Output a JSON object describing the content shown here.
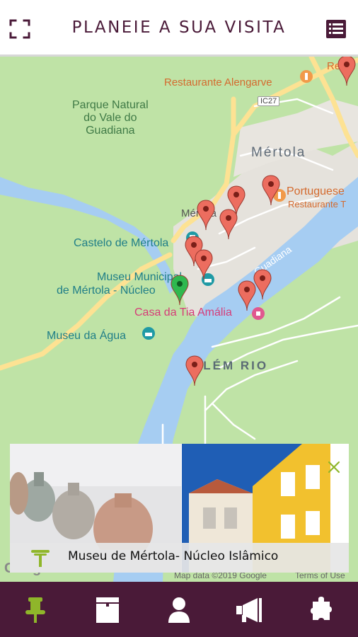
{
  "header": {
    "title": "PLANEIE A SUA VISITA",
    "fullscreen_icon": "fullscreen-icon",
    "list_icon": "list-icon"
  },
  "map": {
    "labels": {
      "park": "Parque Natural\ndo Vale do\nGuadiana",
      "castle": "Castelo de Mértola",
      "museum_municipal_1": "Museu Municipal",
      "museum_municipal_2": "de Mértola - Núcleo",
      "museum_agua": "Museu da Água",
      "casa_tia": "Casa da Tia Amália",
      "restaurante_alengarve": "Restaurante Alengarve",
      "restaurant_top": "Resta",
      "portuguese": "Portuguese",
      "restaurante_t": "Restaurante T",
      "mertola_town": "Mértola",
      "mertola_small": "Mértola",
      "alem_rio": "ALÉM RIO",
      "guadiana": "Guadiana",
      "road_ic27": "IC27",
      "map_data": "Map data ©2019 Google",
      "terms": "Terms of Use",
      "google": "Google"
    },
    "markers_count": 13,
    "colors": {
      "land": "#bfe3a6",
      "water": "#a6cdf2",
      "road": "#fde293",
      "marker_red": "#ec6d5f",
      "marker_green": "#2fb84f"
    }
  },
  "info_card": {
    "title": "Museu de Mértola- Núcleo Islâmico",
    "close_icon": "close-icon",
    "pin_icon": "map-pin-icon"
  },
  "bottom_nav": {
    "items": [
      {
        "icon": "pushpin-icon",
        "active": true
      },
      {
        "icon": "calendar-icon",
        "active": false
      },
      {
        "icon": "person-icon",
        "active": false
      },
      {
        "icon": "megaphone-icon",
        "active": false
      },
      {
        "icon": "puzzle-icon",
        "active": false
      }
    ],
    "active_color": "#8fb62a",
    "icon_color": "#ffffff"
  }
}
